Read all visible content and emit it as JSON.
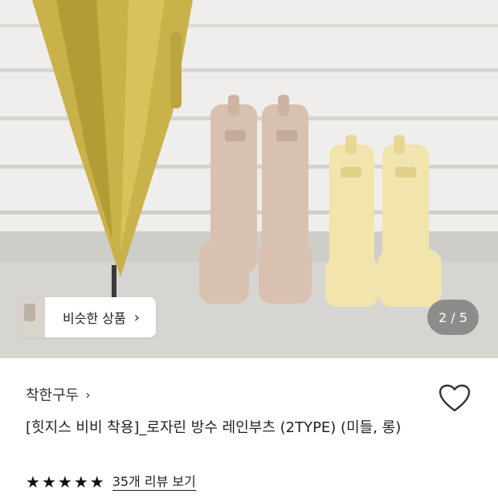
{
  "hero": {
    "similar_products_label": "비슷한 상품",
    "image_counter": "2 / 5"
  },
  "product": {
    "brand": "착한구두",
    "title": "[힛지스 비비 착용]_로자린 방수 레인부츠 (2TYPE) (미들, 롱)",
    "rating": 5,
    "rating_max": 5,
    "review_link": "35개 리뷰 보기"
  },
  "icons": {
    "chevron": "chevron-right-icon",
    "wishlist": "heart-outline-icon",
    "star": "star-icon"
  },
  "colors": {
    "boot_beige": "#d8bfae",
    "boot_yellow": "#efe3a6",
    "umbrella": "#c6b04a"
  }
}
